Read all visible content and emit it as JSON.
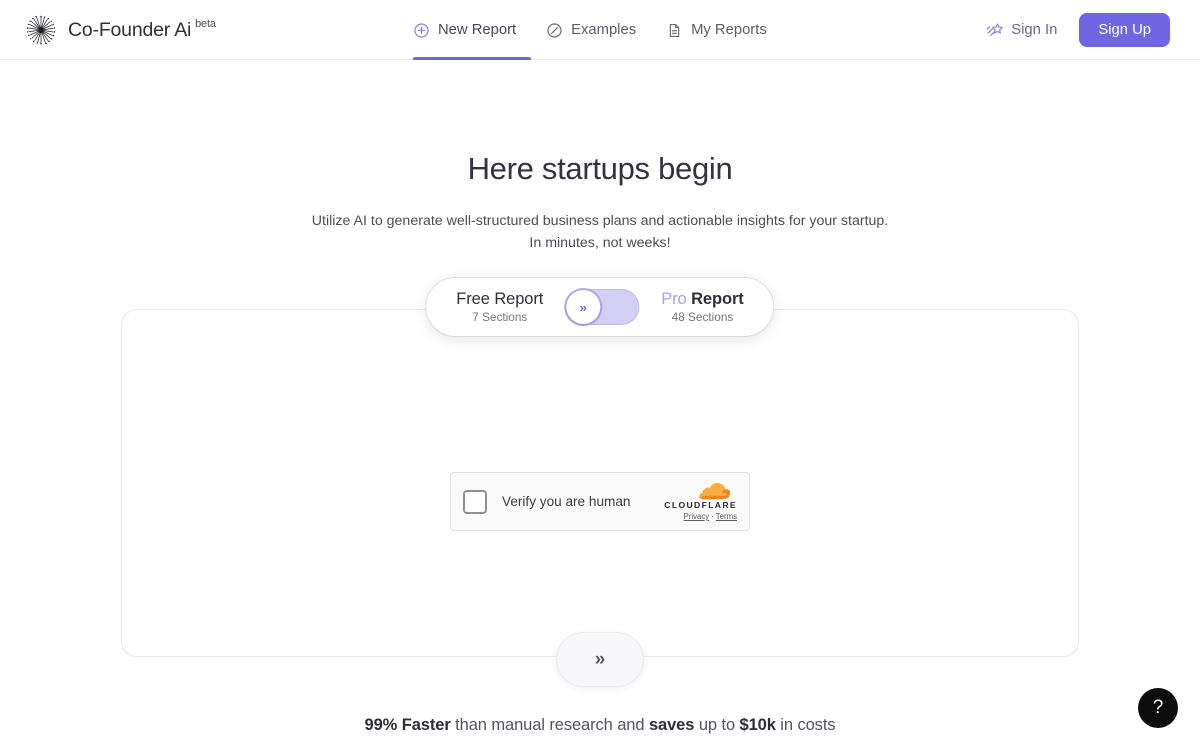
{
  "header": {
    "brand_name": "Co-Founder Ai",
    "brand_badge": "beta",
    "logo_icon": "starburst-logo-icon",
    "nav": [
      {
        "label": "New Report",
        "icon": "plus-circle-icon",
        "active": true
      },
      {
        "label": "Examples",
        "icon": "compass-icon",
        "active": false
      },
      {
        "label": "My Reports",
        "icon": "document-icon",
        "active": false
      }
    ],
    "sign_in_label": "Sign In",
    "sign_in_icon": "shooting-star-icon",
    "sign_up_label": "Sign Up",
    "accent_color": "#6f66e3",
    "active_underline_color": "#6f67d6"
  },
  "hero": {
    "title": "Here startups begin",
    "subtitle_line1": "Utilize AI to generate well-structured business plans and actionable insights for your startup.",
    "subtitle_line2": "In minutes, not weeks!"
  },
  "plan_toggle": {
    "free": {
      "title": "Free Report",
      "sections": "7 Sections"
    },
    "pro": {
      "title_accent": "Pro",
      "title_rest": " Report",
      "sections": "48 Sections"
    },
    "switch_state": "free",
    "knob_icon": "double-chevron-right-icon",
    "knob_glyph": "»",
    "track_color": "#d4d0f3"
  },
  "turnstile": {
    "checkbox_state": "unchecked",
    "label": "Verify you are human",
    "brand_wordmark": "CLOUDFLARE",
    "brand_icon": "cloudflare-cloud-icon",
    "privacy_label": "Privacy",
    "separator": "·",
    "terms_label": "Terms",
    "cloud_color_dark": "#f0851f",
    "cloud_color_light": "#fbad41"
  },
  "next_button": {
    "icon": "double-chevron-right-icon",
    "glyph": "»"
  },
  "footnote": {
    "bold1": "99% Faster",
    "text1": " than manual research and ",
    "bold2": "saves",
    "text2": " up to ",
    "bold3": "$10k",
    "text3": " in costs"
  },
  "help_fab": {
    "icon": "question-mark-icon",
    "glyph": "?"
  }
}
